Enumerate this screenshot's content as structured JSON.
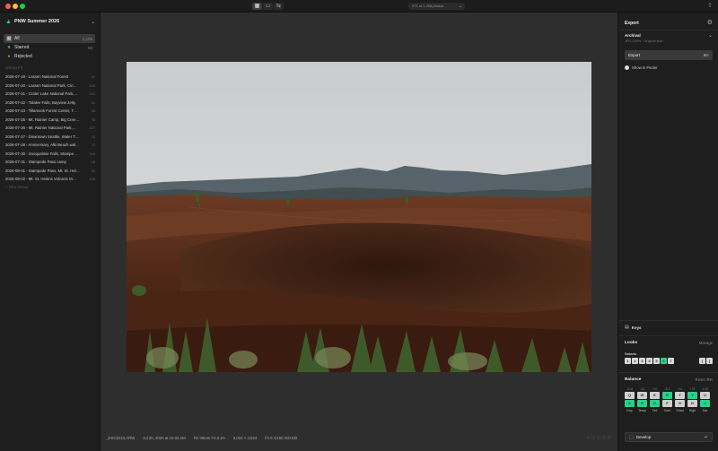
{
  "titlebar": {
    "view_icons": [
      "grid-view-icon",
      "single-view-icon",
      "compare-view-icon"
    ],
    "photo_count": "471 of 1,208 photos"
  },
  "sidebar": {
    "library_title": "PNW Summer 2026",
    "filters": [
      {
        "icon": "all-icon",
        "label": "All",
        "count": "1,208"
      },
      {
        "icon": "star-icon",
        "label": "Starred",
        "count": "53"
      },
      {
        "icon": "reject-icon",
        "label": "Rejected",
        "count": ""
      }
    ],
    "groups_header": "GROUPS",
    "groups": [
      {
        "name": "2026-07-19 - Lassen National Forest",
        "count": "47"
      },
      {
        "name": "2026-07-20 - Lassen National Park, Cin…",
        "count": "103"
      },
      {
        "name": "2026-07-21 - Crater Lake National Park,…",
        "count": "112"
      },
      {
        "name": "2026-07-22 - Tolalee Falls, Bayview Jetty",
        "count": "41"
      },
      {
        "name": "2026-07-23 - Tillamook Forest Center, T…",
        "count": "38"
      },
      {
        "name": "2026-07-25 - Mt. Rainier Camp, Big Cree…",
        "count": "78"
      },
      {
        "name": "2026-07-26 - Mt. Rainier National Park,…",
        "count": "107"
      },
      {
        "name": "2026-07-27 - Downtown Seattle, Water T…",
        "count": "76"
      },
      {
        "name": "2026-07-28 - Anniversary, Alki Beach wal…",
        "count": "72"
      },
      {
        "name": "2026-07-30 - Snoqualmie Falls, Stampe…",
        "count": "119"
      },
      {
        "name": "2026-07-31 - Stampede Pass camp",
        "count": "28"
      },
      {
        "name": "2026-08-01 - Stampede Pass, Mt. St. Hel…",
        "count": "80"
      },
      {
        "name": "2026-08-02 - Mt. St. Helens Volcanic M…",
        "count": "108"
      }
    ],
    "new_group": "New Group"
  },
  "viewer": {
    "filename": "_DSC6243.ARW",
    "datetime": "Jul 20, 2026 at 10:33 AM",
    "lens": "FE 35mm F2.8 ZA",
    "dimensions": "6,024 × 4,024",
    "exposure": "f/4.5  1/160  ISO100",
    "rating_stars": "☆☆☆☆☆"
  },
  "right_panel": {
    "title": "Export",
    "preset_name": "Archival",
    "preset_sub": "JPG 100% · Original size",
    "export_label": "Export",
    "export_shortcut": "⌘E",
    "finder_label": "Show in Finder",
    "keys_label": "Keys",
    "looks_title": "Looks",
    "looks_manage": "Manage",
    "looks_sub": "Solaris",
    "looks_keys": [
      "1",
      "2",
      "3",
      "4",
      "5",
      "6",
      "7"
    ],
    "looks_green_index": 5,
    "looks_nav": [
      "[",
      "]"
    ],
    "balance_title": "Balance",
    "balance_reset": "Reset ⌘R",
    "balance_cols": [
      {
        "val": "-0.04",
        "top": "Q",
        "bottom": "A",
        "label": "Exp",
        "top_green": false,
        "bottom_green": true
      },
      {
        "val": "-34",
        "top": "W",
        "bottom": "S",
        "label": "Temp",
        "top_green": false,
        "bottom_green": true
      },
      {
        "val": "+10",
        "top": "E",
        "bottom": "D",
        "label": "Tint",
        "top_green": false,
        "bottom_green": true
      },
      {
        "val": "-6.3",
        "top": "R",
        "bottom": "F",
        "label": "Cont",
        "top_green": true,
        "bottom_green": false
      },
      {
        "val": "+31",
        "top": "T",
        "bottom": "G",
        "label": "Shad",
        "top_green": false,
        "bottom_green": false
      },
      {
        "val": "+78",
        "top": "Y",
        "bottom": "H",
        "label": "High",
        "top_green": true,
        "bottom_green": false
      },
      {
        "val": "-0.49",
        "top": "U",
        "bottom": "J",
        "label": "Sat",
        "top_green": false,
        "bottom_green": true
      }
    ],
    "develop_label": "Develop",
    "develop_shortcut": "↵"
  },
  "colors": {
    "accent": "#29d08a",
    "reject": "#e7792b"
  }
}
